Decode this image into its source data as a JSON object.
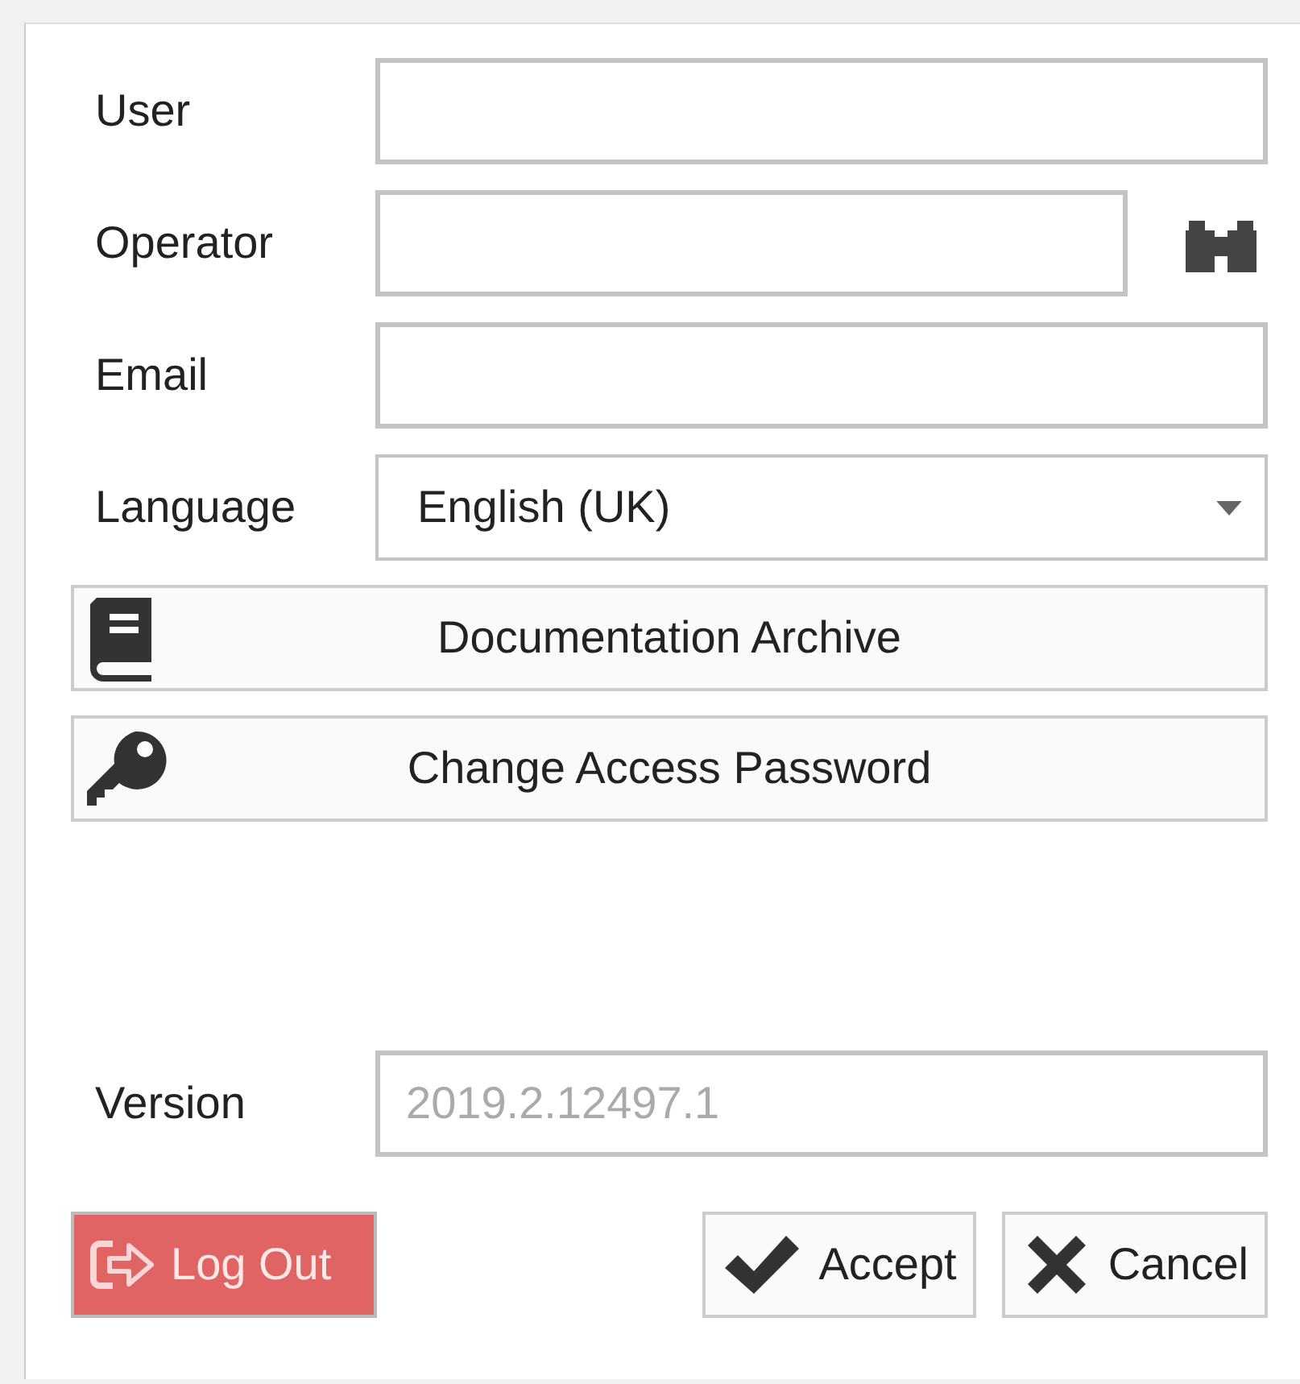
{
  "fields": [
    {
      "kind": "text",
      "label": "User"
    },
    {
      "kind": "lookup",
      "label": "Operator"
    },
    {
      "kind": "text",
      "label": "Email"
    },
    {
      "kind": "select",
      "label": "Language",
      "value": "English (UK)"
    }
  ],
  "actions": [
    {
      "kind": "book",
      "label": "Documentation Archive"
    },
    {
      "kind": "key",
      "label": "Change Access Password"
    }
  ],
  "version": {
    "label": "Version",
    "value": "2019.2.12497.1",
    "disabled": true
  },
  "footer": {
    "logout": "Log Out",
    "accept": "Accept",
    "cancel": "Cancel"
  }
}
